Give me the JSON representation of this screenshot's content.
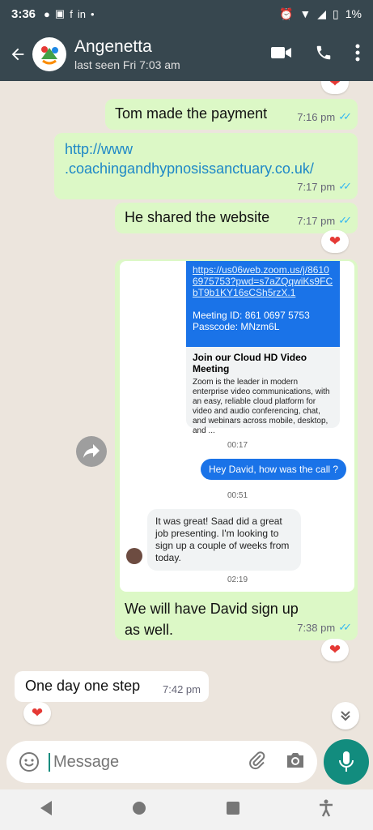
{
  "status": {
    "time": "3:36",
    "battery": "1%"
  },
  "header": {
    "title": "Angenetta",
    "subtitle": "last seen Fri 7:03 am"
  },
  "messages": {
    "m1_text": "Tom made the payment",
    "m1_time": "7:16 pm",
    "m2_text_line1": "http://www",
    "m2_text_line2": ".coachingandhypnosissanctuary.co.uk/",
    "m2_time": "7:17 pm",
    "m3_text": "He shared the website",
    "m3_time": "7:17 pm",
    "m4_text": "We will have David sign up as well.",
    "m4_time": "7:38 pm",
    "m5_text": "One day one step",
    "m5_time": "7:42 pm"
  },
  "screenshot": {
    "link": "https://us06web.zoom.us/j/86106975753?pwd=s7aZQqwiKs9FCbT9b1KY16sCSh5rzX.1",
    "meeting_id": "Meeting ID: 861 0697 5753",
    "passcode": "Passcode: MNzm6L",
    "card_title": "Join our Cloud HD Video Meeting",
    "card_desc": "Zoom is the leader in modern enterprise video communications, with an easy, reliable cloud platform for video and audio conferencing, chat, and webinars across mobile, desktop, and ...",
    "t1": "00:17",
    "pill": "Hey David, how was the call ?",
    "t2": "00:51",
    "reply": "It was great! Saad did a great job presenting. I'm looking to sign up a couple of weeks from today.",
    "t3": "02:19"
  },
  "composer": {
    "placeholder": "Message"
  },
  "icons": {
    "back": "arrow-left-icon",
    "video": "video-call-icon",
    "call": "phone-icon",
    "menu": "more-vert-icon",
    "emoji": "emoji-icon",
    "attach": "paperclip-icon",
    "camera": "camera-icon",
    "mic": "mic-icon",
    "forward": "forward-icon",
    "scroll": "chevron-double-down-icon",
    "reaction": "heart-icon"
  },
  "colors": {
    "header": "#37474f",
    "outgoing": "#dcf8c6",
    "incoming": "#ffffff",
    "accent": "#128c7e",
    "ticks": "#34b7f1"
  }
}
